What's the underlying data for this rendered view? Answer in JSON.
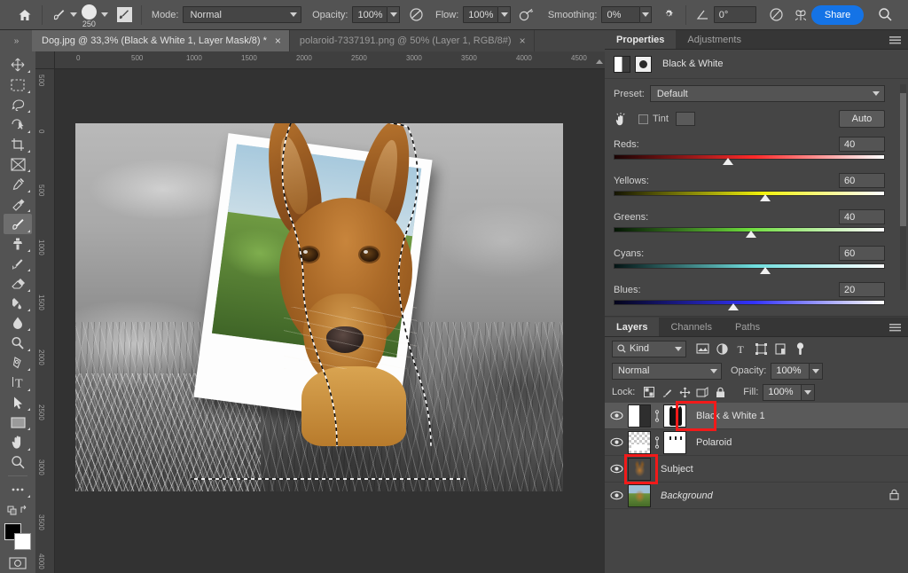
{
  "options_bar": {
    "home_icon": "home-icon",
    "brush_preset_icon": "brush-icon",
    "brush_size": "250",
    "brush_panel_icon": "brush-settings-icon",
    "mode_label": "Mode:",
    "mode_value": "Normal",
    "opacity_label": "Opacity:",
    "opacity_value": "100%",
    "pressure_opacity_icon": "pressure-opacity-icon",
    "flow_label": "Flow:",
    "flow_value": "100%",
    "airbrush_icon": "airbrush-icon",
    "smoothing_label": "Smoothing:",
    "smoothing_value": "0%",
    "smoothing_options_icon": "gear-icon",
    "angle_icon": "angle-icon",
    "angle_value": "0°",
    "pressure_size_icon": "pressure-size-icon",
    "symmetry_icon": "symmetry-butterfly-icon",
    "share_label": "Share",
    "search_icon": "search-icon"
  },
  "tabs": {
    "collapse_icon": "double-chevron-right-icon",
    "items": [
      {
        "title": "Dog.jpg @ 33,3% (Black & White 1, Layer Mask/8) *",
        "close": "×",
        "active": true
      },
      {
        "title": "polaroid-7337191.png @ 50% (Layer 1, RGB/8#)",
        "close": "×",
        "active": false
      }
    ]
  },
  "toolbar": {
    "tools": [
      {
        "name": "move-tool",
        "selected": false
      },
      {
        "name": "rectangular-marquee-tool",
        "selected": false
      },
      {
        "name": "lasso-tool",
        "selected": false
      },
      {
        "name": "object-selection-tool",
        "selected": false
      },
      {
        "name": "crop-tool",
        "selected": false
      },
      {
        "name": "frame-tool",
        "selected": false
      },
      {
        "name": "eyedropper-tool",
        "selected": false
      },
      {
        "name": "spot-healing-brush-tool",
        "selected": false
      },
      {
        "name": "brush-tool",
        "selected": true
      },
      {
        "name": "clone-stamp-tool",
        "selected": false
      },
      {
        "name": "history-brush-tool",
        "selected": false
      },
      {
        "name": "eraser-tool",
        "selected": false
      },
      {
        "name": "gradient-tool",
        "selected": false
      },
      {
        "name": "blur-tool",
        "selected": false
      },
      {
        "name": "dodge-tool",
        "selected": false
      },
      {
        "name": "pen-tool",
        "selected": false
      },
      {
        "name": "type-tool",
        "selected": false
      },
      {
        "name": "path-selection-tool",
        "selected": false
      },
      {
        "name": "rectangle-tool",
        "selected": false
      },
      {
        "name": "hand-tool",
        "selected": false
      },
      {
        "name": "zoom-tool",
        "selected": false
      },
      {
        "name": "edit-toolbar-tool",
        "selected": false
      },
      {
        "name": "quick-mask-tool",
        "selected": false
      },
      {
        "name": "screen-mode-tool",
        "selected": false
      }
    ],
    "foreground_color": "#000000",
    "background_color": "#ffffff"
  },
  "rulers": {
    "horizontal_ticks": [
      "0",
      "500",
      "1000",
      "1500",
      "2000",
      "2500",
      "3000",
      "3500",
      "4000",
      "4500"
    ],
    "vertical_ticks": [
      "500",
      "0",
      "500",
      "1000",
      "1500",
      "2000",
      "2500",
      "3000",
      "3500",
      "4000"
    ]
  },
  "properties_panel": {
    "tabs": [
      {
        "label": "Properties",
        "active": true
      },
      {
        "label": "Adjustments",
        "active": false
      }
    ],
    "menu_icon": "panel-menu-icon",
    "adjustment_title": "Black & White",
    "preset_label": "Preset:",
    "preset_value": "Default",
    "hand_tool_icon": "on-image-adjust-icon",
    "tint_label": "Tint",
    "tint_checked": false,
    "tint_color": "#5a5a5a",
    "auto_label": "Auto",
    "sliders": [
      {
        "label": "Reds:",
        "value": "40",
        "percent": 40,
        "from": "#1a0404",
        "to": "#ffffff",
        "mid": "#ff2a2a"
      },
      {
        "label": "Yellows:",
        "value": "60",
        "percent": 60,
        "from": "#141404",
        "to": "#ffffff",
        "mid": "#f2f20c"
      },
      {
        "label": "Greens:",
        "value": "40",
        "percent": 40,
        "from": "#041404",
        "to": "#ffffff",
        "mid": "#4ce04c"
      },
      {
        "label": "Cyans:",
        "value": "60",
        "percent": 60,
        "from": "#041414",
        "to": "#ffffff",
        "mid": "#5ce0e0"
      },
      {
        "label": "Blues:",
        "value": "20",
        "percent": 20,
        "from": "#04041a",
        "to": "#ffffff",
        "mid": "#3333ff"
      }
    ],
    "footer_buttons": [
      {
        "name": "clip-to-layer-button",
        "active": false
      },
      {
        "name": "toggle-previous-state-button",
        "active": false
      },
      {
        "name": "reset-button",
        "active": false
      },
      {
        "name": "toggle-visibility-button",
        "active": true
      },
      {
        "name": "delete-button",
        "active": false
      }
    ]
  },
  "layers_panel": {
    "tabs": [
      {
        "label": "Layers",
        "active": true
      },
      {
        "label": "Channels",
        "active": false
      },
      {
        "label": "Paths",
        "active": false
      }
    ],
    "menu_icon": "panel-menu-icon",
    "filter_kind_label": "Kind",
    "filter_search_icon": "search-icon",
    "filter_icons": [
      "pixel-filter-icon",
      "adjustment-filter-icon",
      "type-filter-icon",
      "shape-filter-icon",
      "smart-object-filter-icon",
      "filter-toggle-icon"
    ],
    "blend_mode": "Normal",
    "opacity_label": "Opacity:",
    "opacity_value": "100%",
    "lock_label": "Lock:",
    "lock_icons": [
      "lock-transparent-pixels-icon",
      "lock-image-pixels-icon",
      "lock-position-icon",
      "lock-artboard-icon",
      "lock-all-icon"
    ],
    "fill_label": "Fill:",
    "fill_value": "100%",
    "rows": [
      {
        "name": "Black & White 1",
        "visible": true,
        "active": true,
        "italic": false,
        "locked": false,
        "has_mask": true,
        "highlighted": true,
        "thumb": "adjustment-thumbnail",
        "mask_thumb": "layer-mask-thumbnail"
      },
      {
        "name": "Polaroid",
        "visible": true,
        "active": false,
        "italic": false,
        "locked": false,
        "has_mask": true,
        "highlighted": false,
        "thumb": "polaroid-thumbnail",
        "mask_thumb": "polaroid-mask-thumbnail"
      },
      {
        "name": "Subject",
        "visible": true,
        "active": false,
        "italic": false,
        "locked": false,
        "has_mask": false,
        "highlighted": true,
        "thumb": "subject-thumbnail"
      },
      {
        "name": "Background",
        "visible": true,
        "active": false,
        "italic": true,
        "locked": true,
        "has_mask": false,
        "highlighted": false,
        "thumb": "background-thumbnail"
      }
    ]
  },
  "canvas": {
    "description": "Grayscale outdoor photo with a tilted white polaroid frame and a color photo of a brown dog; marching-ants selection outlines the dog."
  },
  "colors": {
    "accent": "#1473e6",
    "panel_bg": "#454545",
    "toolbar_bg": "#535353",
    "canvas_bg": "#323232",
    "annotation_red": "#f21a1a"
  }
}
